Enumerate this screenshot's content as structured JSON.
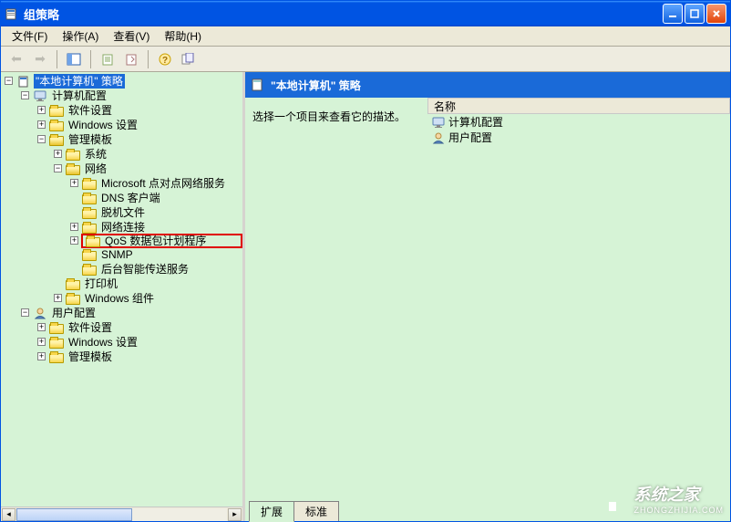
{
  "window": {
    "title": "组策略"
  },
  "menu": {
    "file": "文件(F)",
    "action": "操作(A)",
    "view": "查看(V)",
    "help": "帮助(H)"
  },
  "tree": {
    "root": "\"本地计算机\" 策略",
    "computer": "计算机配置",
    "software": "软件设置",
    "windows": "Windows 设置",
    "admin": "管理模板",
    "system": "系统",
    "network": "网络",
    "ms_p2p": "Microsoft 点对点网络服务",
    "dns": "DNS 客户端",
    "offline": "脱机文件",
    "netconn": "网络连接",
    "qos": "QoS 数据包计划程序",
    "snmp": "SNMP",
    "bits": "后台智能传送服务",
    "printers": "打印机",
    "components": "Windows 组件",
    "user": "用户配置",
    "user_software": "软件设置",
    "user_windows": "Windows 设置",
    "user_admin": "管理模板"
  },
  "right": {
    "header": "\"本地计算机\" 策略",
    "desc": "选择一个项目来查看它的描述。",
    "name_col": "名称",
    "items": {
      "computer": "计算机配置",
      "user": "用户配置"
    }
  },
  "tabs": {
    "extended": "扩展",
    "standard": "标准"
  },
  "watermark": {
    "main": "系统之家",
    "sub": "ZHONGZHIJIA.COM"
  }
}
